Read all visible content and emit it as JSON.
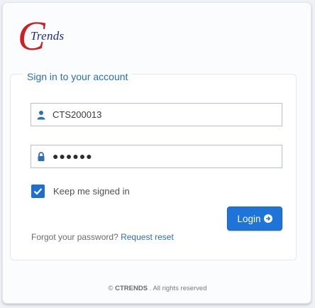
{
  "logo": {
    "letter": "C",
    "text": "Trends"
  },
  "form": {
    "legend": "Sign in to your account",
    "username_value": "CTS200013",
    "password_dots": "●●●●●●",
    "remember_label": "Keep me signed in",
    "remember_checked": true,
    "login_label": "Login"
  },
  "forgot": {
    "text": "Forgot your password?",
    "link": "Request reset"
  },
  "footer": {
    "copyright_symbol": "©",
    "brand": "CTRENDS",
    "rest": ". All rights reserved"
  },
  "colors": {
    "accent": "#1e74d9",
    "logo_red": "#cf1f24",
    "logo_blue": "#1a2c8c"
  }
}
